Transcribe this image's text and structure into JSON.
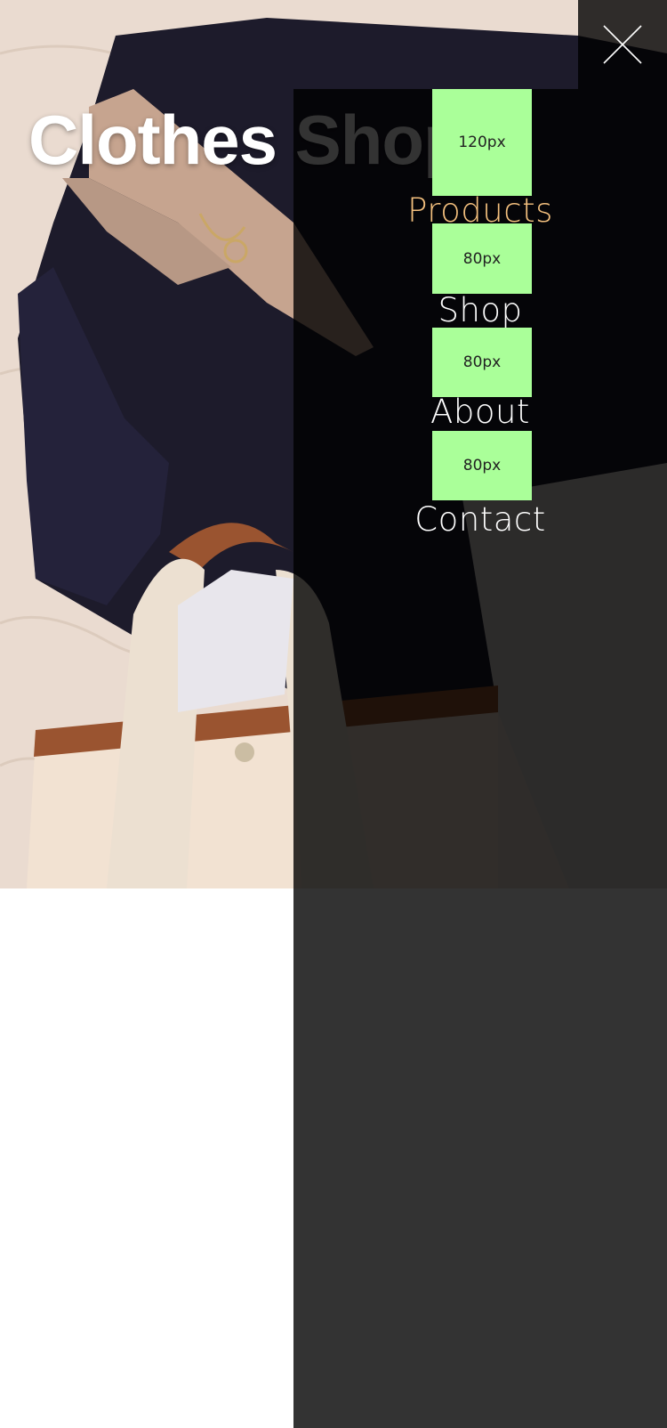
{
  "hero": {
    "title": "Clothes Shop",
    "image_alt": "Flat lay of a black blazer, striped shirt, gold necklace and a cream canvas tote bag on a quilted bedspread"
  },
  "menu": {
    "close_icon": "close-icon",
    "items": [
      {
        "spacer": "120px",
        "label": "Products",
        "active": true
      },
      {
        "spacer": "80px",
        "label": "Shop",
        "active": false
      },
      {
        "spacer": "80px",
        "label": "About",
        "active": false
      },
      {
        "spacer": "80px",
        "label": "Contact",
        "active": false
      }
    ]
  },
  "colors": {
    "drawer_overlay": "#000000",
    "active_link": "#f4c07e",
    "link": "#ffffff",
    "spacer_fill": "#aaff99",
    "page_background": "#ffffff"
  }
}
